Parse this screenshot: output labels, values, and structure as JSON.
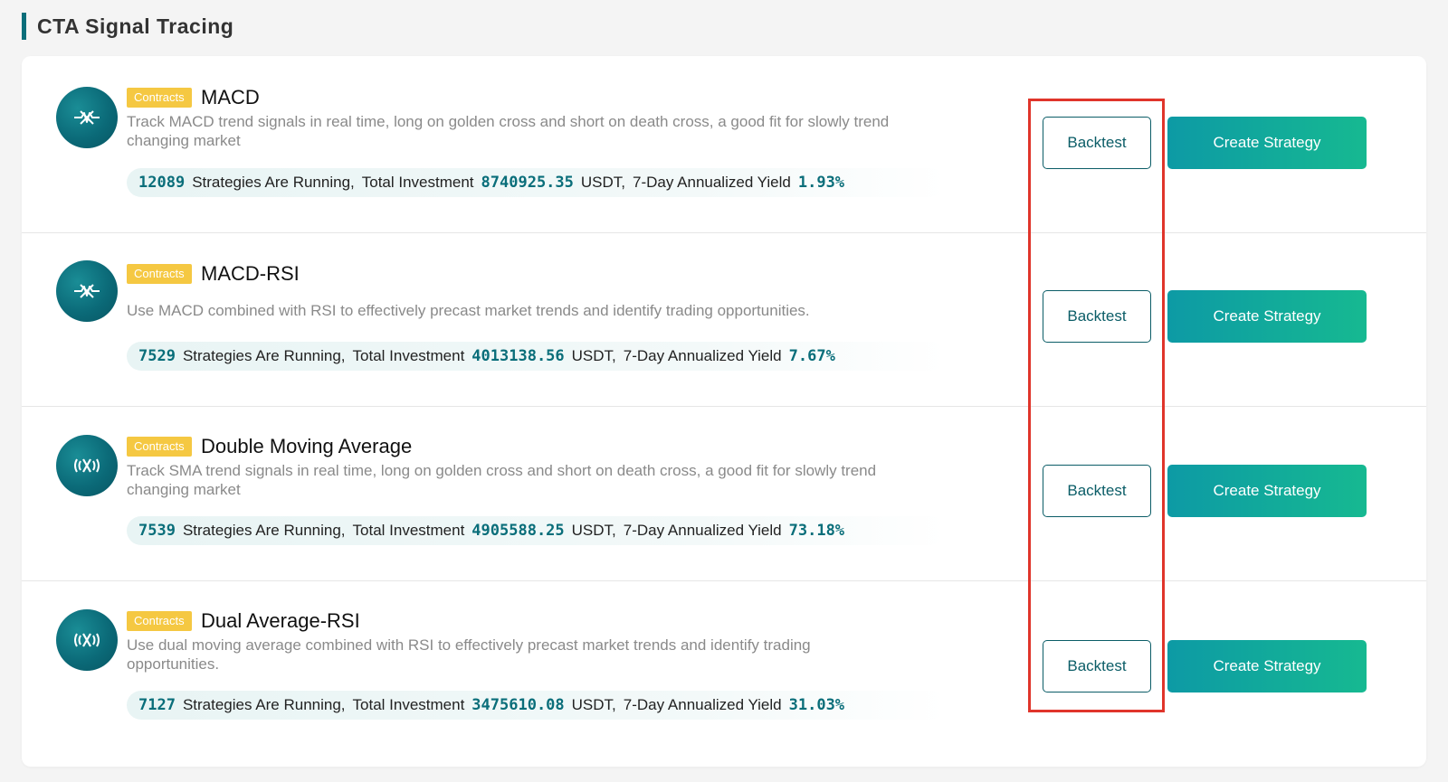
{
  "section_title": "CTA Signal Tracing",
  "colors": {
    "accent": "#0a6e7a",
    "tag": "#f5c842",
    "highlight": "#e0352b",
    "button_gradient_start": "#0d9aa5",
    "button_gradient_end": "#16b991"
  },
  "strategies": [
    {
      "icon": "pulse-cross-icon",
      "tag": "Contracts",
      "name": "MACD",
      "description": "Track MACD trend signals in real time, long on golden cross and short on death cross, a good fit for slowly trend changing market",
      "running_count": "12089",
      "running_label": "Strategies Are Running,",
      "investment_label": "Total Investment",
      "investment": "8740925.35",
      "currency_label": "USDT,",
      "yield_label": "7-Day Annualized Yield",
      "yield": "1.93%",
      "backtest_label": "Backtest",
      "create_label": "Create Strategy"
    },
    {
      "icon": "pulse-cross-icon",
      "tag": "Contracts",
      "name": "MACD-RSI",
      "description": "Use MACD combined with RSI to effectively precast market trends and identify trading opportunities.",
      "running_count": "7529",
      "running_label": "Strategies Are Running,",
      "investment_label": "Total Investment",
      "investment": "4013138.56",
      "currency_label": "USDT,",
      "yield_label": "7-Day Annualized Yield",
      "yield": "7.67%",
      "backtest_label": "Backtest",
      "create_label": "Create Strategy"
    },
    {
      "icon": "broadcast-x-icon",
      "tag": "Contracts",
      "name": "Double Moving Average",
      "description": "Track SMA trend signals in real time, long on golden cross and short on death cross, a good fit for slowly trend changing market",
      "running_count": "7539",
      "running_label": "Strategies Are Running,",
      "investment_label": "Total Investment",
      "investment": "4905588.25",
      "currency_label": "USDT,",
      "yield_label": "7-Day Annualized Yield",
      "yield": "73.18%",
      "backtest_label": "Backtest",
      "create_label": "Create Strategy"
    },
    {
      "icon": "broadcast-x-icon",
      "tag": "Contracts",
      "name": "Dual Average-RSI",
      "description": "Use dual moving average combined with RSI to effectively precast market trends and identify trading opportunities.",
      "running_count": "7127",
      "running_label": "Strategies Are Running,",
      "investment_label": "Total Investment",
      "investment": "3475610.08",
      "currency_label": "USDT,",
      "yield_label": "7-Day Annualized Yield",
      "yield": "31.03%",
      "backtest_label": "Backtest",
      "create_label": "Create Strategy"
    }
  ]
}
